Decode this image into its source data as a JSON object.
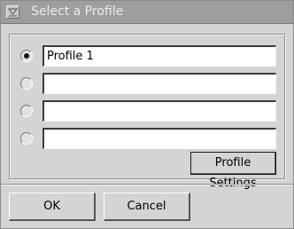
{
  "window": {
    "title": "Select a Profile",
    "icon": "window-menu-icon"
  },
  "profiles": [
    {
      "value": "Profile 1",
      "selected": true
    },
    {
      "value": "",
      "selected": false
    },
    {
      "value": "",
      "selected": false
    },
    {
      "value": "",
      "selected": false
    }
  ],
  "buttons": {
    "profile_settings": "Profile Settings",
    "ok": "OK",
    "cancel": "Cancel"
  }
}
